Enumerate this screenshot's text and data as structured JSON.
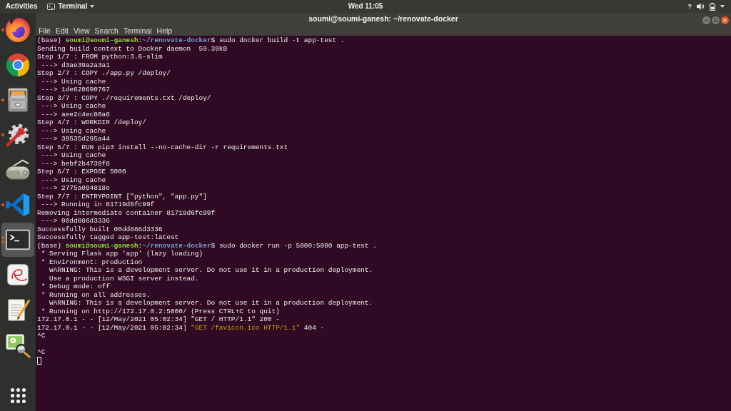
{
  "top_bar": {
    "activities": "Activities",
    "app_menu": "Terminal",
    "clock": "Wed 11:05",
    "help_glyph": "?"
  },
  "dock": {
    "items": [
      {
        "kind": "globe_browser",
        "running": true,
        "multiple": false,
        "selected": false
      },
      {
        "kind": "ring_browser",
        "running": false,
        "multiple": false,
        "selected": false
      },
      {
        "kind": "file_cabinet",
        "running": true,
        "multiple": false,
        "selected": false
      },
      {
        "kind": "settings",
        "running": true,
        "multiple": false,
        "selected": false
      },
      {
        "kind": "scanner",
        "running": false,
        "multiple": false,
        "selected": false
      },
      {
        "kind": "code_editor",
        "running": true,
        "multiple": false,
        "selected": false
      },
      {
        "kind": "terminal",
        "running": true,
        "multiple": true,
        "selected": true
      },
      {
        "kind": "document_viewer",
        "running": false,
        "multiple": false,
        "selected": false
      },
      {
        "kind": "text_editor",
        "running": false,
        "multiple": false,
        "selected": false
      },
      {
        "kind": "image_viewer",
        "running": false,
        "multiple": false,
        "selected": false
      }
    ]
  },
  "window": {
    "title": "soumi@soumi-ganesh: ~/renovate-docker",
    "menu": [
      "File",
      "Edit",
      "View",
      "Search",
      "Terminal",
      "Help"
    ]
  },
  "terminal": {
    "lines": [
      {
        "kind": "text",
        "segments": [
          {
            "text": "(base) ",
            "kind": "plain"
          },
          {
            "text": "soumi@soumi-ganesh",
            "kind": "user"
          },
          {
            "text": ":",
            "kind": "plain"
          },
          {
            "text": "~/renovate-docker",
            "kind": "path"
          },
          {
            "text": "$ sudo docker build -t app-test .",
            "kind": "plain"
          }
        ]
      },
      {
        "kind": "text",
        "segments": [
          {
            "text": "Sending build context to Docker daemon  59.39kB",
            "kind": "plain"
          }
        ]
      },
      {
        "kind": "text",
        "segments": [
          {
            "text": "Step 1/7 : FROM python:3.6-slim",
            "kind": "plain"
          }
        ]
      },
      {
        "kind": "text",
        "segments": [
          {
            "text": " ---> d3ae39a2a3a1",
            "kind": "plain"
          }
        ]
      },
      {
        "kind": "text",
        "segments": [
          {
            "text": "Step 2/7 : COPY ./app.py /deploy/",
            "kind": "plain"
          }
        ]
      },
      {
        "kind": "text",
        "segments": [
          {
            "text": " ---> Using cache",
            "kind": "plain"
          }
        ]
      },
      {
        "kind": "text",
        "segments": [
          {
            "text": " ---> 1de620690767",
            "kind": "plain"
          }
        ]
      },
      {
        "kind": "text",
        "segments": [
          {
            "text": "Step 3/7 : COPY ./requirements.txt /deploy/",
            "kind": "plain"
          }
        ]
      },
      {
        "kind": "text",
        "segments": [
          {
            "text": " ---> Using cache",
            "kind": "plain"
          }
        ]
      },
      {
        "kind": "text",
        "segments": [
          {
            "text": " ---> aee2c4ec80a8",
            "kind": "plain"
          }
        ]
      },
      {
        "kind": "text",
        "segments": [
          {
            "text": "Step 4/7 : WORKDIR /deploy/",
            "kind": "plain"
          }
        ]
      },
      {
        "kind": "text",
        "segments": [
          {
            "text": " ---> Using cache",
            "kind": "plain"
          }
        ]
      },
      {
        "kind": "text",
        "segments": [
          {
            "text": " ---> 39535d295a44",
            "kind": "plain"
          }
        ]
      },
      {
        "kind": "text",
        "segments": [
          {
            "text": "Step 5/7 : RUN pip3 install --no-cache-dir -r requirements.txt",
            "kind": "plain"
          }
        ]
      },
      {
        "kind": "text",
        "segments": [
          {
            "text": " ---> Using cache",
            "kind": "plain"
          }
        ]
      },
      {
        "kind": "text",
        "segments": [
          {
            "text": " ---> bebf2b4739f8",
            "kind": "plain"
          }
        ]
      },
      {
        "kind": "text",
        "segments": [
          {
            "text": "Step 6/7 : EXPOSE 5000",
            "kind": "plain"
          }
        ]
      },
      {
        "kind": "text",
        "segments": [
          {
            "text": " ---> Using cache",
            "kind": "plain"
          }
        ]
      },
      {
        "kind": "text",
        "segments": [
          {
            "text": " ---> 2775a094818e",
            "kind": "plain"
          }
        ]
      },
      {
        "kind": "text",
        "segments": [
          {
            "text": "Step 7/7 : ENTRYPOINT [\"python\", \"app.py\"]",
            "kind": "plain"
          }
        ]
      },
      {
        "kind": "text",
        "segments": [
          {
            "text": " ---> Running in 81719d6fc99f",
            "kind": "plain"
          }
        ]
      },
      {
        "kind": "text",
        "segments": [
          {
            "text": "Removing intermediate container 81719d6fc99f",
            "kind": "plain"
          }
        ]
      },
      {
        "kind": "text",
        "segments": [
          {
            "text": " ---> 00dd886d3336",
            "kind": "plain"
          }
        ]
      },
      {
        "kind": "text",
        "segments": [
          {
            "text": "Successfully built 00dd886d3336",
            "kind": "plain"
          }
        ]
      },
      {
        "kind": "text",
        "segments": [
          {
            "text": "Successfully tagged app-test:latest",
            "kind": "plain"
          }
        ]
      },
      {
        "kind": "text",
        "segments": [
          {
            "text": "(base) ",
            "kind": "plain"
          },
          {
            "text": "soumi@soumi-ganesh",
            "kind": "user"
          },
          {
            "text": ":",
            "kind": "plain"
          },
          {
            "text": "~/renovate-docker",
            "kind": "path"
          },
          {
            "text": "$ sudo docker run -p 5000:5000 app-test .",
            "kind": "plain"
          }
        ]
      },
      {
        "kind": "text",
        "segments": [
          {
            "text": " * Serving Flask app 'app' (lazy loading)",
            "kind": "plain"
          }
        ]
      },
      {
        "kind": "text",
        "segments": [
          {
            "text": " * Environment: production",
            "kind": "plain"
          }
        ]
      },
      {
        "kind": "text",
        "segments": [
          {
            "text": "   WARNING: This is a development server. Do not use it in a production deployment.",
            "kind": "plain"
          }
        ]
      },
      {
        "kind": "text",
        "segments": [
          {
            "text": "   Use a production WSGI server instead.",
            "kind": "plain"
          }
        ]
      },
      {
        "kind": "text",
        "segments": [
          {
            "text": " * Debug mode: off",
            "kind": "plain"
          }
        ]
      },
      {
        "kind": "text",
        "segments": [
          {
            "text": " * Running on all addresses.",
            "kind": "plain"
          }
        ]
      },
      {
        "kind": "text",
        "segments": [
          {
            "text": "   WARNING: This is a development server. Do not use it in a production deployment.",
            "kind": "plain"
          }
        ]
      },
      {
        "kind": "text",
        "segments": [
          {
            "text": " * Running on http://172.17.0.2:5000/ (Press CTRL+C to quit)",
            "kind": "plain"
          }
        ]
      },
      {
        "kind": "text",
        "segments": [
          {
            "text": "172.17.0.1 - - [12/May/2021 05:02:34] \"GET / HTTP/1.1\" 200 -",
            "kind": "plain"
          }
        ]
      },
      {
        "kind": "text",
        "segments": [
          {
            "text": "172.17.0.1 - - [12/May/2021 05:02:34] ",
            "kind": "plain"
          },
          {
            "text": "\"GET /favicon.ico HTTP/1.1\"",
            "kind": "highlight"
          },
          {
            "text": " 404 -",
            "kind": "plain"
          }
        ]
      },
      {
        "kind": "text",
        "segments": [
          {
            "text": "^C",
            "kind": "plain"
          }
        ]
      },
      {
        "kind": "blank"
      },
      {
        "kind": "text",
        "segments": [
          {
            "text": "^C",
            "kind": "plain"
          }
        ]
      }
    ],
    "cursor": {
      "filled": false
    }
  }
}
